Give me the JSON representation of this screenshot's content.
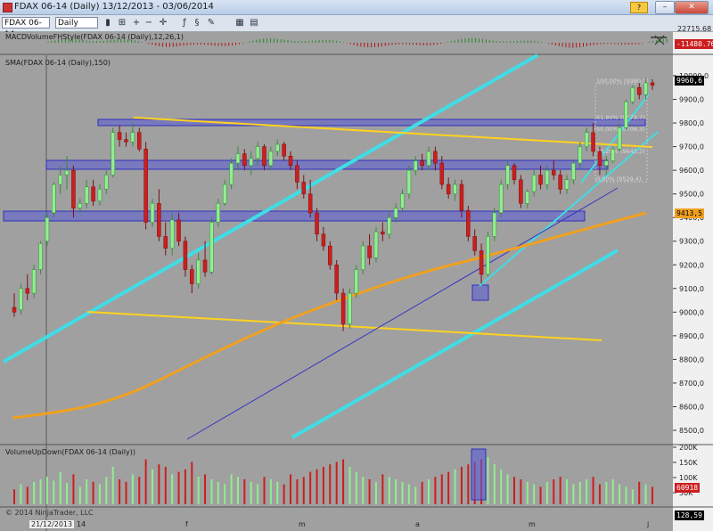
{
  "window": {
    "title": "FDAX 06-14 (Daily)  13/12/2013 - 03/06/2014"
  },
  "toolbar": {
    "symbol": "FDAX 06-14",
    "interval": "Daily"
  },
  "macd": {
    "label": "MACDVolumeFHStyle(FDAX 06-14 (Daily),12,26,1)",
    "top_value": "22715.68",
    "current_value": "-11480.76"
  },
  "price_pane": {
    "label": "SMA(FDAX 06-14 (Daily),150)",
    "y_ticks": [
      "10000,0",
      "9900,0",
      "9800,0",
      "9700,0",
      "9600,0",
      "9500,0",
      "9400,0",
      "9300,0",
      "9200,0",
      "9100,0",
      "9000,0",
      "8900,0",
      "8800,0",
      "8700,0",
      "8600,0",
      "8500,0"
    ],
    "last_price": "9960,6",
    "sma_value": "9413,5",
    "fib_labels": [
      "100,00% (9980,0)",
      "61,80% (9773,7)",
      "50,00% (9708,3)",
      "38,20% (9642,2)",
      "0,00% (9529,4)"
    ]
  },
  "volume_pane": {
    "label": "VolumeUpDown(FDAX 06-14 (Daily))",
    "y_ticks": [
      "200K",
      "150K",
      "100K",
      "50K"
    ],
    "current_value": "60918"
  },
  "bottom": {
    "copyright": "© 2014 NinjaTrader, LLC",
    "value": "128,59",
    "date_marker": "21/12/2013",
    "x_labels": [
      "14",
      "f",
      "m",
      "a",
      "m",
      "j"
    ]
  },
  "colors": {
    "up": "#90ee90",
    "down": "#cc1e1e",
    "channel": "#3fdde6",
    "trend": "#ffd21e",
    "sma": "#f0a020",
    "zone": "#5a5ad6"
  },
  "chart_data": {
    "type": "candlestick",
    "ylim": [
      8400,
      10100
    ],
    "ohlc_approx": [
      [
        9020,
        9080,
        8980,
        9000
      ],
      [
        9010,
        9120,
        8990,
        9100
      ],
      [
        9100,
        9160,
        9050,
        9080
      ],
      [
        9080,
        9200,
        9060,
        9180
      ],
      [
        9180,
        9300,
        9160,
        9290
      ],
      [
        9300,
        9420,
        9280,
        9400
      ],
      [
        9420,
        9550,
        9400,
        9540
      ],
      [
        9540,
        9620,
        9500,
        9580
      ],
      [
        9580,
        9660,
        9520,
        9600
      ],
      [
        9600,
        9620,
        9400,
        9440
      ],
      [
        9440,
        9480,
        9420,
        9460
      ],
      [
        9460,
        9560,
        9440,
        9530
      ],
      [
        9530,
        9560,
        9450,
        9470
      ],
      [
        9470,
        9540,
        9450,
        9520
      ],
      [
        9520,
        9600,
        9500,
        9580
      ],
      [
        9580,
        9780,
        9570,
        9760
      ],
      [
        9760,
        9790,
        9700,
        9730
      ],
      [
        9730,
        9760,
        9700,
        9720
      ],
      [
        9720,
        9800,
        9700,
        9760
      ],
      [
        9760,
        9780,
        9680,
        9690
      ],
      [
        9690,
        9720,
        9350,
        9380
      ],
      [
        9380,
        9480,
        9360,
        9460
      ],
      [
        9460,
        9520,
        9300,
        9320
      ],
      [
        9320,
        9380,
        9240,
        9270
      ],
      [
        9270,
        9420,
        9240,
        9390
      ],
      [
        9390,
        9420,
        9280,
        9300
      ],
      [
        9300,
        9320,
        9150,
        9180
      ],
      [
        9180,
        9200,
        9080,
        9120
      ],
      [
        9120,
        9250,
        9100,
        9220
      ],
      [
        9220,
        9300,
        9150,
        9170
      ],
      [
        9170,
        9400,
        9160,
        9380
      ],
      [
        9380,
        9480,
        9360,
        9460
      ],
      [
        9460,
        9560,
        9450,
        9540
      ],
      [
        9540,
        9650,
        9520,
        9630
      ],
      [
        9630,
        9700,
        9600,
        9670
      ],
      [
        9670,
        9690,
        9600,
        9620
      ],
      [
        9620,
        9680,
        9580,
        9650
      ],
      [
        9650,
        9720,
        9620,
        9700
      ],
      [
        9700,
        9710,
        9600,
        9620
      ],
      [
        9620,
        9700,
        9600,
        9680
      ],
      [
        9680,
        9730,
        9660,
        9710
      ],
      [
        9710,
        9720,
        9640,
        9660
      ],
      [
        9660,
        9680,
        9600,
        9620
      ],
      [
        9620,
        9640,
        9520,
        9550
      ],
      [
        9550,
        9580,
        9480,
        9500
      ],
      [
        9500,
        9560,
        9400,
        9420
      ],
      [
        9420,
        9440,
        9300,
        9330
      ],
      [
        9330,
        9360,
        9260,
        9280
      ],
      [
        9280,
        9300,
        9180,
        9200
      ],
      [
        9200,
        9220,
        9050,
        9080
      ],
      [
        9080,
        9100,
        8920,
        8950
      ],
      [
        8950,
        9100,
        8930,
        9080
      ],
      [
        9080,
        9200,
        9060,
        9180
      ],
      [
        9180,
        9300,
        9160,
        9280
      ],
      [
        9280,
        9330,
        9200,
        9230
      ],
      [
        9230,
        9360,
        9210,
        9340
      ],
      [
        9340,
        9380,
        9300,
        9330
      ],
      [
        9330,
        9420,
        9310,
        9400
      ],
      [
        9400,
        9460,
        9380,
        9440
      ],
      [
        9440,
        9520,
        9420,
        9500
      ],
      [
        9500,
        9620,
        9480,
        9600
      ],
      [
        9600,
        9660,
        9580,
        9640
      ],
      [
        9640,
        9670,
        9600,
        9620
      ],
      [
        9620,
        9700,
        9600,
        9680
      ],
      [
        9680,
        9700,
        9600,
        9630
      ],
      [
        9630,
        9660,
        9520,
        9540
      ],
      [
        9540,
        9570,
        9480,
        9500
      ],
      [
        9500,
        9560,
        9470,
        9540
      ],
      [
        9540,
        9560,
        9400,
        9430
      ],
      [
        9430,
        9450,
        9300,
        9320
      ],
      [
        9320,
        9350,
        9240,
        9260
      ],
      [
        9260,
        9290,
        9120,
        9160
      ],
      [
        9160,
        9340,
        9150,
        9320
      ],
      [
        9320,
        9440,
        9300,
        9420
      ],
      [
        9420,
        9560,
        9400,
        9540
      ],
      [
        9540,
        9640,
        9520,
        9620
      ],
      [
        9620,
        9630,
        9540,
        9560
      ],
      [
        9560,
        9580,
        9440,
        9460
      ],
      [
        9460,
        9520,
        9440,
        9510
      ],
      [
        9510,
        9600,
        9490,
        9580
      ],
      [
        9580,
        9620,
        9520,
        9540
      ],
      [
        9540,
        9620,
        9520,
        9600
      ],
      [
        9600,
        9640,
        9560,
        9580
      ],
      [
        9580,
        9600,
        9500,
        9520
      ],
      [
        9520,
        9580,
        9500,
        9560
      ],
      [
        9560,
        9640,
        9540,
        9630
      ],
      [
        9630,
        9720,
        9610,
        9700
      ],
      [
        9700,
        9780,
        9680,
        9760
      ],
      [
        9760,
        9800,
        9660,
        9680
      ],
      [
        9680,
        9700,
        9580,
        9620
      ],
      [
        9620,
        9660,
        9580,
        9640
      ],
      [
        9640,
        9700,
        9630,
        9690
      ],
      [
        9690,
        9800,
        9680,
        9780
      ],
      [
        9780,
        9900,
        9770,
        9890
      ],
      [
        9890,
        9960,
        9880,
        9950
      ],
      [
        9950,
        9970,
        9900,
        9920
      ],
      [
        9920,
        9990,
        9900,
        9970
      ],
      [
        9970,
        9985,
        9940,
        9960
      ]
    ],
    "volume_approx": [
      60,
      80,
      70,
      90,
      100,
      110,
      95,
      130,
      85,
      120,
      70,
      100,
      90,
      80,
      110,
      150,
      100,
      90,
      120,
      110,
      180,
      140,
      160,
      150,
      120,
      130,
      140,
      170,
      110,
      120,
      100,
      90,
      80,
      120,
      110,
      100,
      90,
      80,
      110,
      100,
      90,
      80,
      120,
      100,
      110,
      130,
      140,
      150,
      160,
      170,
      180,
      150,
      130,
      110,
      100,
      90,
      120,
      110,
      100,
      90,
      80,
      70,
      90,
      100,
      110,
      120,
      130,
      140,
      150,
      160,
      170,
      180,
      190,
      160,
      140,
      120,
      110,
      100,
      90,
      80,
      70,
      90,
      100,
      110,
      100,
      80,
      90,
      100,
      110,
      80,
      90,
      100,
      80,
      70,
      60,
      90,
      80,
      70
    ]
  }
}
